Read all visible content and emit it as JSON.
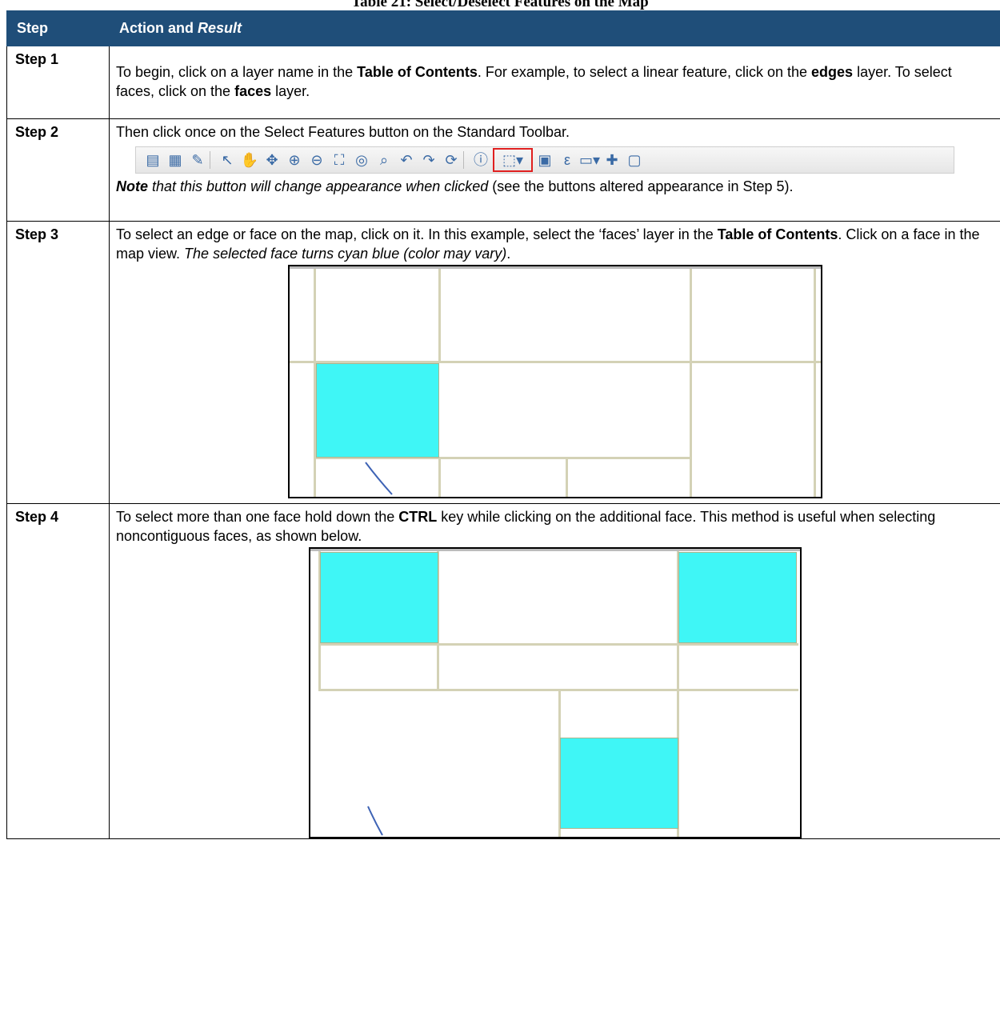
{
  "caption": "Table 21: Select/Deselect Features on the Map",
  "headers": {
    "step": "Step",
    "action": "Action and ",
    "result": "Result"
  },
  "steps": [
    {
      "label": "Step 1",
      "p1": "To begin, click on a layer name in the ",
      "p1b": "Table of Contents",
      "p2": ". For example, to select a linear feature, click on the ",
      "p2b": "edges",
      "p3": " layer. To select faces, click on the ",
      "p3b": "faces",
      "p4": " layer."
    },
    {
      "label": "Step 2",
      "p1": "Then click once on the Select Features button on the Standard Toolbar.",
      "note_b": "Note",
      "note_i": " that this button will change appearance when clicked",
      "note_rest": " (see the buttons altered appearance in Step 5)."
    },
    {
      "label": "Step 3",
      "p1": "To select an edge or face on the map, click on it. In this example, select the ‘faces’ layer in the ",
      "p1b": "Table of Contents",
      "p2": ". Click on a face in the map view. ",
      "p2i": "The selected face turns cyan blue (color may vary)",
      "p3": "."
    },
    {
      "label": "Step 4",
      "p1": "To select more than one face hold down the ",
      "p1b": "CTRL",
      "p2": " key while clicking on the additional face. This method is useful when selecting noncontiguous faces, as shown below."
    }
  ],
  "toolbar_icons": [
    "save-icon",
    "new-map-icon",
    "edit-icon",
    "pointer-icon",
    "pan-hand-icon",
    "pan-to-selection-icon",
    "zoom-in-icon",
    "zoom-out-icon",
    "zoom-full-icon",
    "zoom-layer-icon",
    "zoom-selection-icon",
    "zoom-last-icon",
    "zoom-next-icon",
    "refresh-icon",
    "identify-icon",
    "select-features-icon",
    "deselect-icon",
    "expression-select-icon",
    "measure-icon",
    "add-feature-icon",
    "new-layer-icon"
  ],
  "colors": {
    "header_bg": "#1f4e79",
    "selected_face": "#3ff6f6",
    "road": "#d4d2b6"
  }
}
